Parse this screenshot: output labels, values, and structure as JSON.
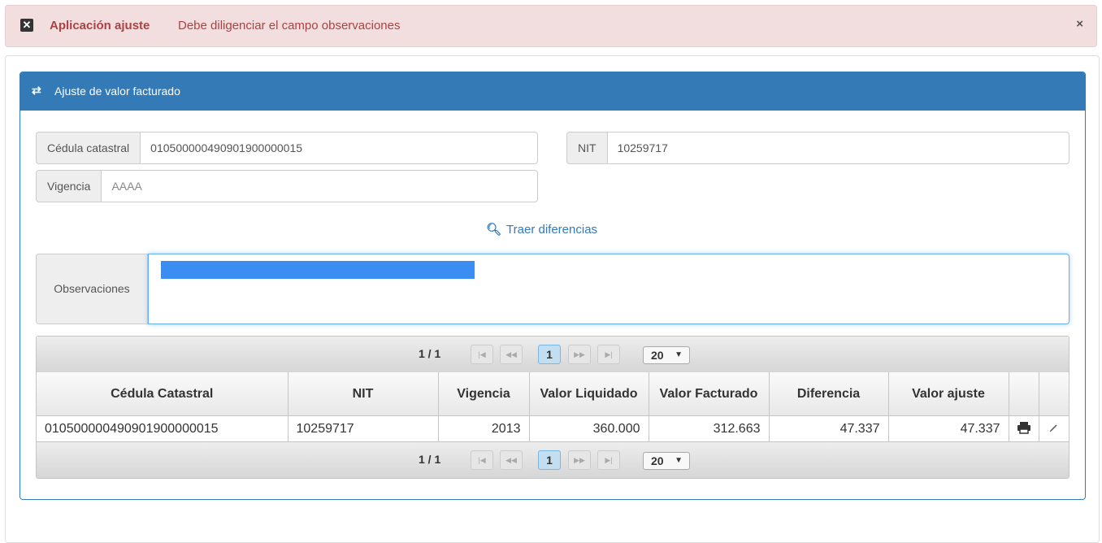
{
  "alert": {
    "icon": "close-box-icon",
    "title": "Aplicación ajuste",
    "message": "Debe diligenciar el campo observaciones",
    "close": "×"
  },
  "panel": {
    "icon": "swap-arrows-icon",
    "title": "Ajuste de valor facturado"
  },
  "form": {
    "cedula_label": "Cédula catastral",
    "cedula_value": "010500000490901900000015",
    "nit_label": "NIT",
    "nit_value": "10259717",
    "vigencia_label": "Vigencia",
    "vigencia_placeholder": "AAAA",
    "fetch_label": "Traer diferencias",
    "observaciones_label": "Observaciones"
  },
  "pager": {
    "info": "1 / 1",
    "current_page": "1",
    "page_size": "20"
  },
  "table": {
    "columns": [
      "Cédula Catastral",
      "NIT",
      "Vigencia",
      "Valor Liquidado",
      "Valor Facturado",
      "Diferencia",
      "Valor ajuste",
      "",
      ""
    ],
    "rows": [
      {
        "cedula": "010500000490901900000015",
        "nit": "10259717",
        "vigencia": "2013",
        "valor_liquidado": "360.000",
        "valor_facturado": "312.663",
        "diferencia": "47.337",
        "valor_ajuste": "47.337",
        "print_icon": "print-icon",
        "edit_icon": "pencil-icon"
      }
    ]
  },
  "colors": {
    "primary": "#337ab7",
    "alert_bg": "#f2dede",
    "alert_text": "#a94442",
    "selection": "#3a8ef2"
  }
}
